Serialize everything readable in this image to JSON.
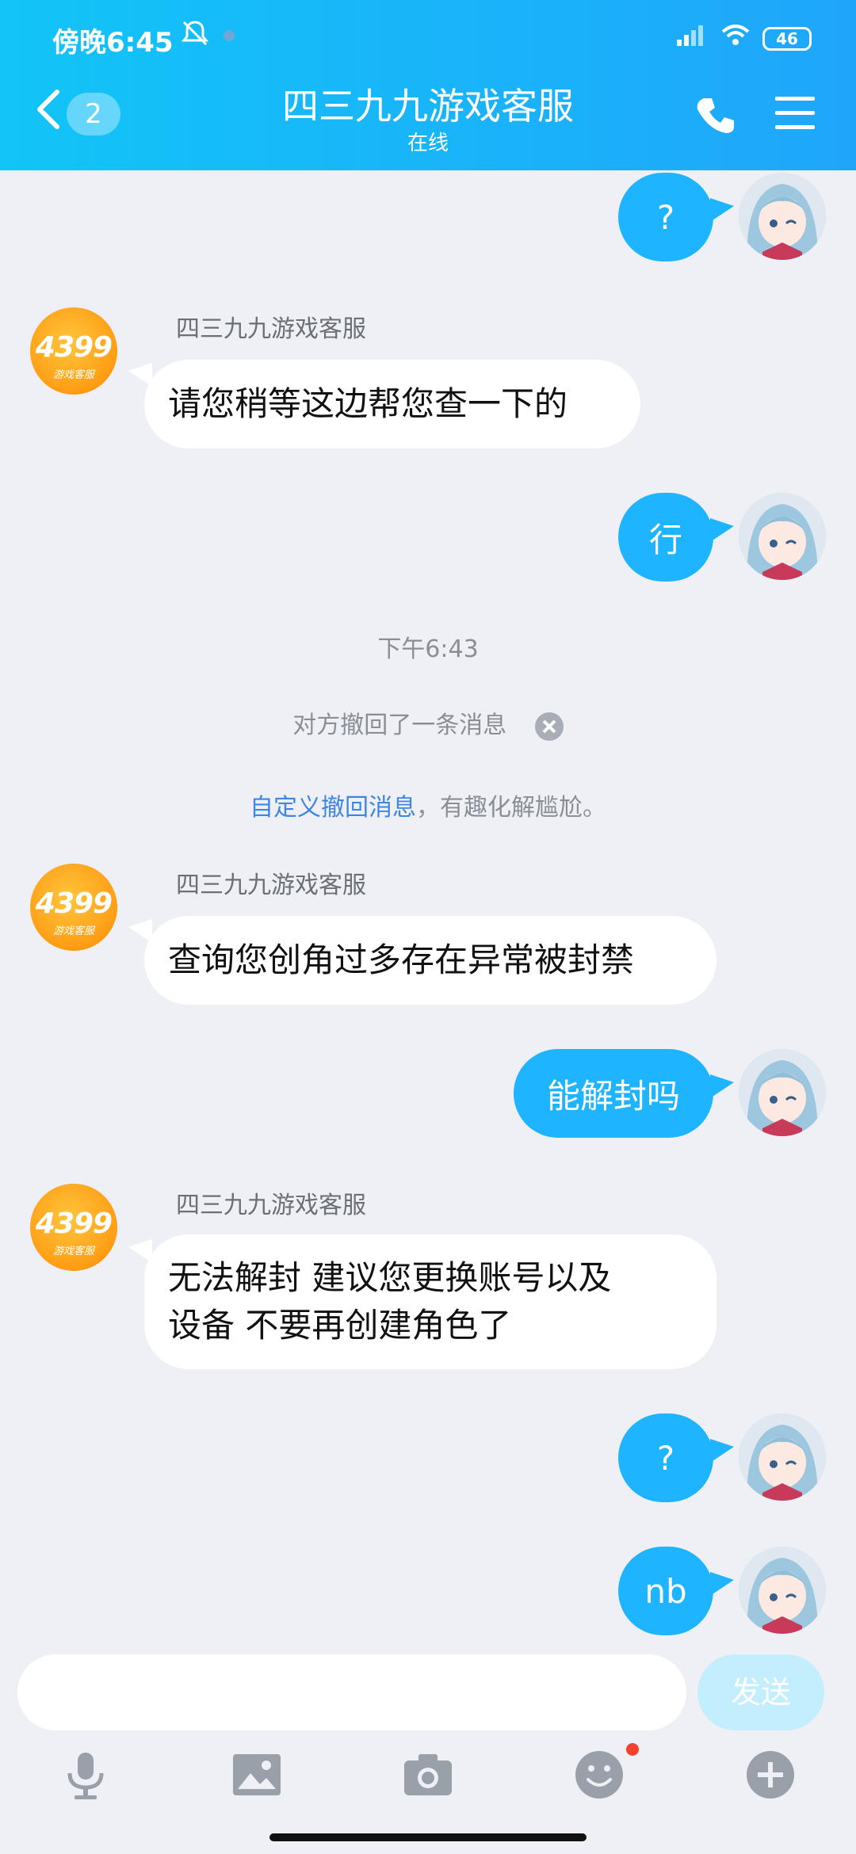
{
  "status_bar": {
    "time": "傍晚6:45",
    "battery": "46"
  },
  "header": {
    "back_count": "2",
    "title": "四三九九游戏客服",
    "subtitle": "在线"
  },
  "cs_logo": {
    "brand": "4399",
    "sub": "游戏客服"
  },
  "messages": [
    {
      "text": "?"
    },
    {
      "sender": "四三九九游戏客服",
      "text": "请您稍等这边帮您查一下的"
    },
    {
      "text": "行"
    },
    {
      "time": "下午6:43"
    },
    {
      "revoke_notice": "对方撤回了一条消息"
    },
    {
      "custom_link": "自定义撤回消息",
      "custom_suffix": "，有趣化解尴尬。"
    },
    {
      "sender": "四三九九游戏客服",
      "text": "查询您创角过多存在异常被封禁"
    },
    {
      "text": "能解封吗"
    },
    {
      "sender": "四三九九游戏客服",
      "line1": "无法解封 建议您更换账号以及",
      "line2": "设备  不要再创建角色了"
    },
    {
      "text": "?"
    },
    {
      "text": "nb"
    }
  ],
  "input": {
    "placeholder": "",
    "send_label": "发送"
  },
  "colors": {
    "header_start": "#12c4f7",
    "header_end": "#1fa6fb",
    "outgoing_bubble": "#1eb4ff",
    "incoming_bubble": "#ffffff",
    "link": "#3d86e4"
  }
}
